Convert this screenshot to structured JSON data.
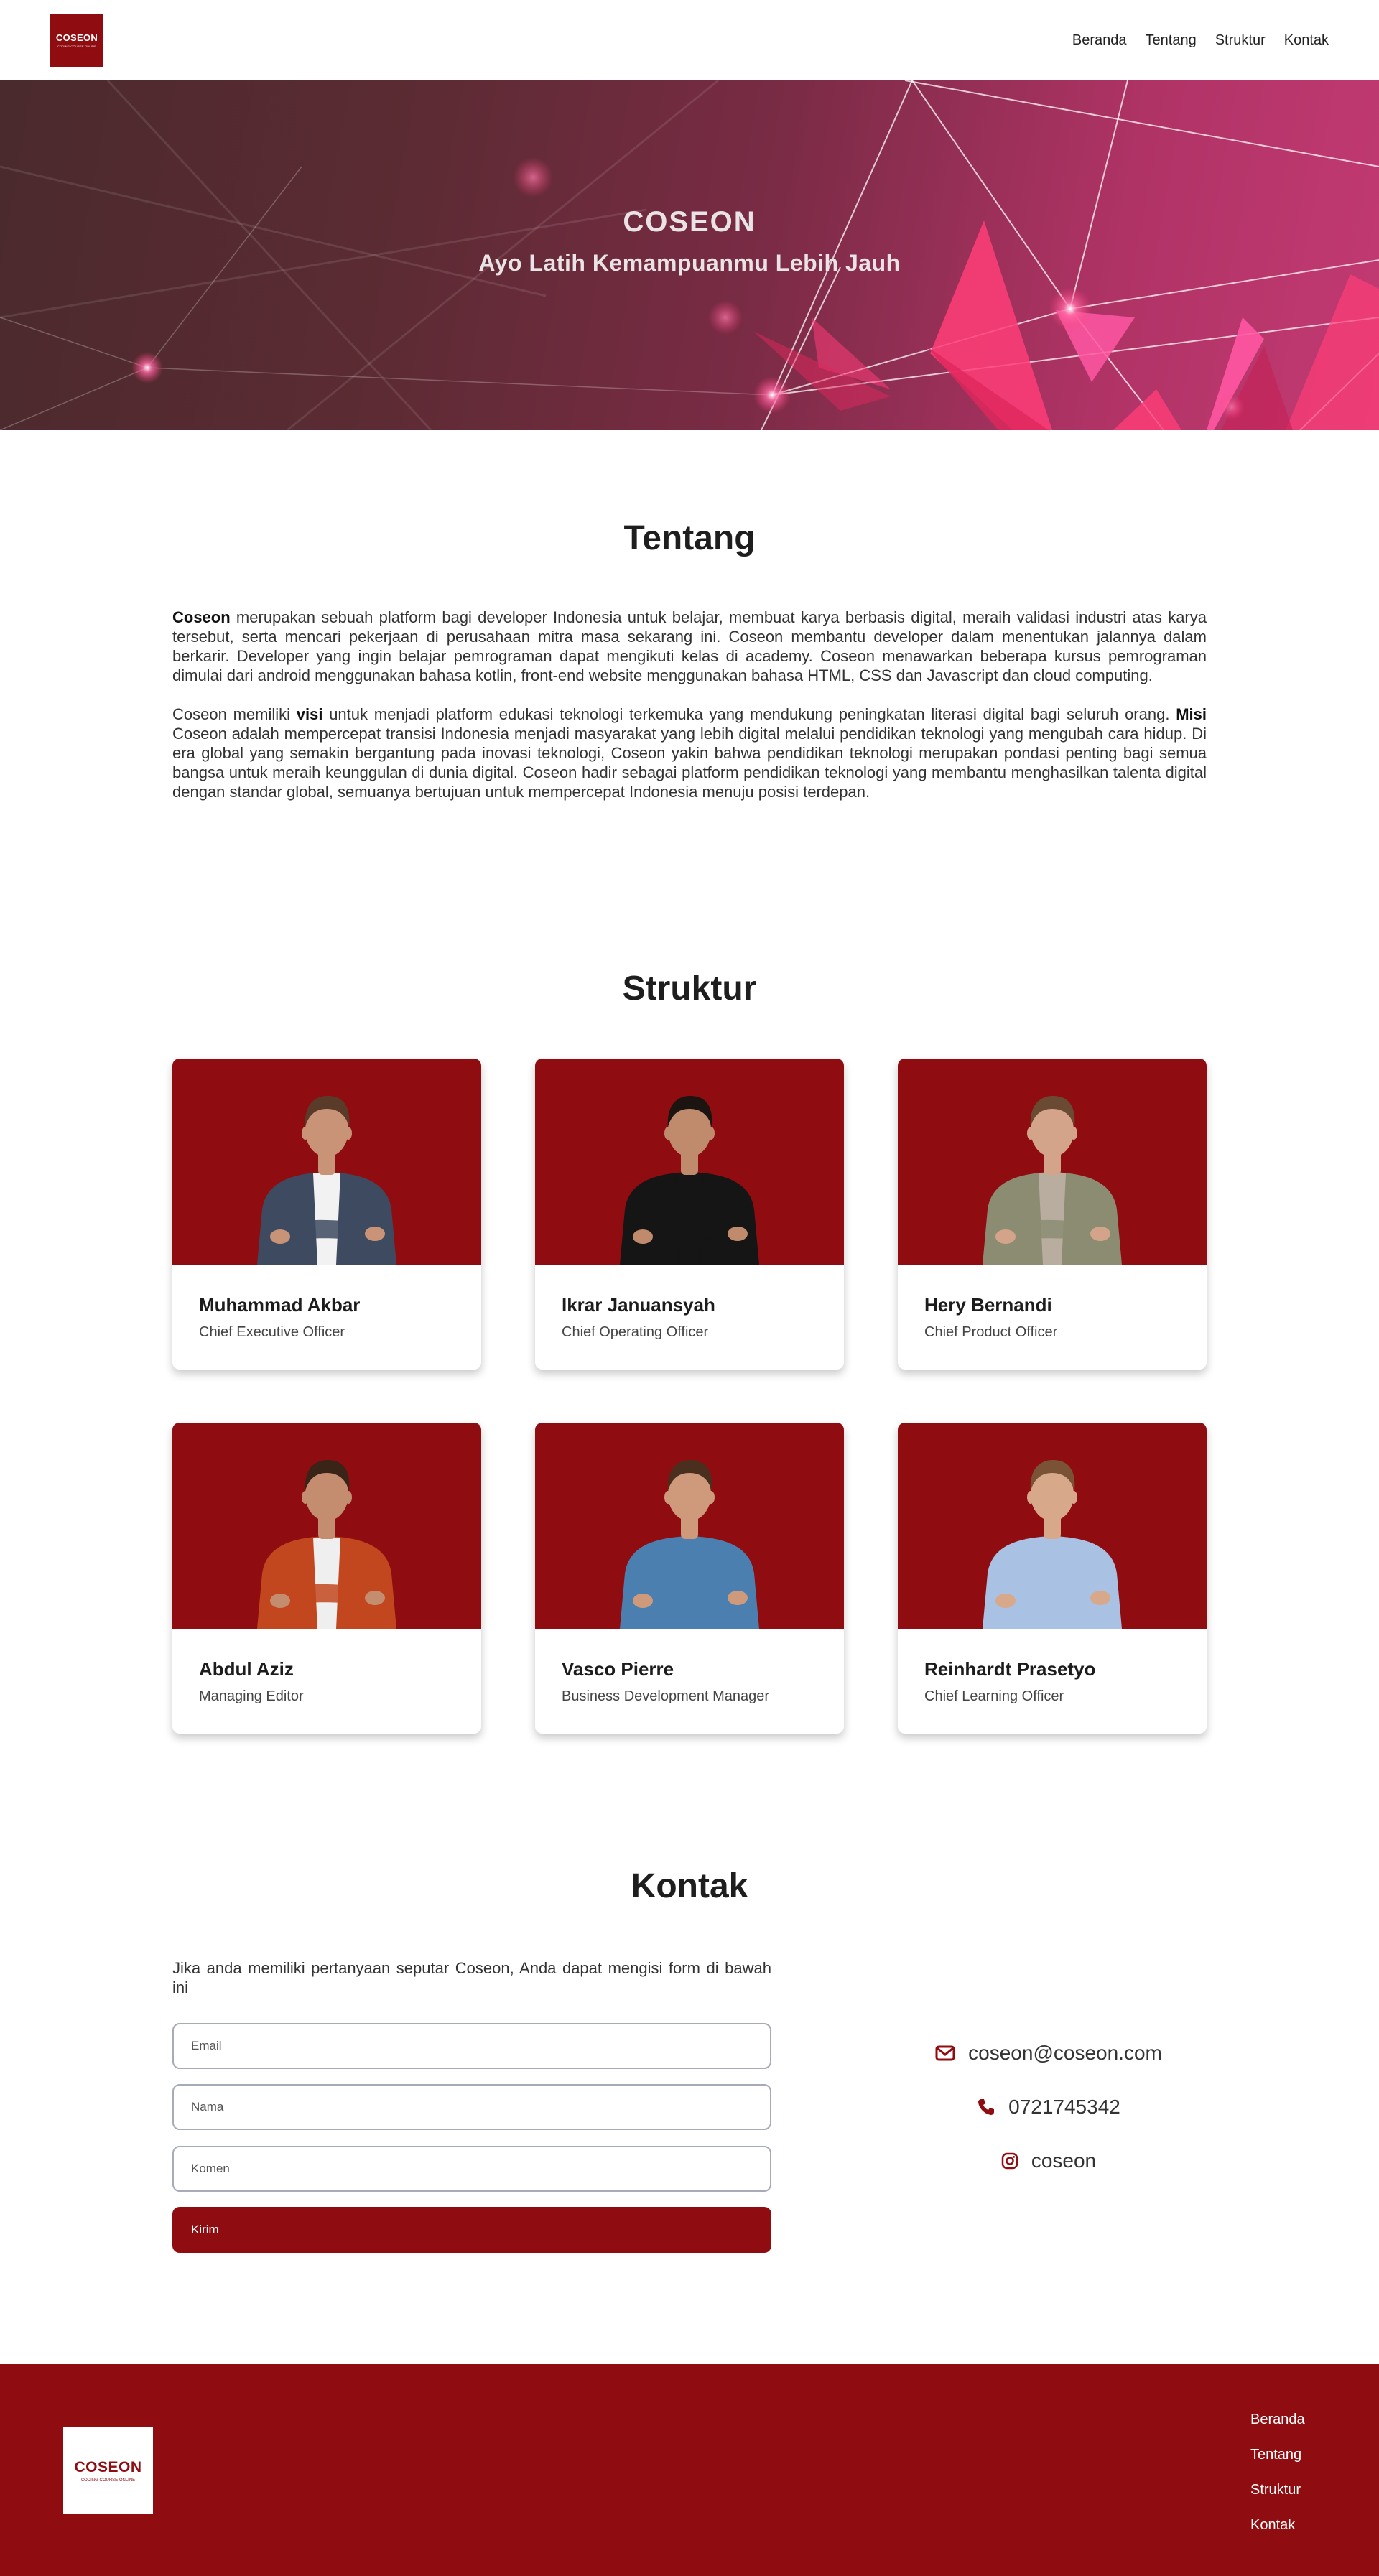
{
  "brand": {
    "name": "COSEON",
    "tagline": "CODING COURSE ONLINE",
    "primary_color": "#8f0d11"
  },
  "nav": {
    "links": [
      "Beranda",
      "Tentang",
      "Struktur",
      "Kontak"
    ]
  },
  "hero": {
    "title": "COSEON",
    "subtitle": "Ayo Latih Kemampuanmu Lebih Jauh"
  },
  "about": {
    "title": "Tentang",
    "p1_bold": "Coseon",
    "p1_text": " merupakan sebuah platform bagi developer Indonesia untuk belajar, membuat karya berbasis digital, meraih validasi industri atas karya tersebut, serta mencari pekerjaan di perusahaan mitra masa sekarang ini. Coseon membantu developer dalam menentukan jalannya dalam berkarir. Developer yang ingin belajar pemrograman dapat mengikuti kelas di academy. Coseon menawarkan beberapa kursus pemrograman dimulai dari android menggunakan bahasa kotlin, front-end website menggunakan bahasa HTML, CSS dan Javascript dan cloud computing.",
    "p2_a": "Coseon memiliki ",
    "p2_visi": "visi",
    "p2_b": " untuk menjadi platform edukasi teknologi terkemuka yang mendukung peningkatan literasi digital bagi seluruh orang. ",
    "p2_misi": "Misi",
    "p2_c": " Coseon adalah mempercepat transisi Indonesia menjadi masyarakat yang lebih digital melalui pendidikan teknologi yang mengubah cara hidup. Di era global yang semakin bergantung pada inovasi teknologi, Coseon yakin bahwa pendidikan teknologi merupakan pondasi penting bagi semua bangsa untuk meraih keunggulan di dunia digital. Coseon hadir sebagai platform pendidikan teknologi yang membantu menghasilkan talenta digital dengan standar global, semuanya bertujuan untuk mempercepat Indonesia menuju posisi terdepan."
  },
  "structure": {
    "title": "Struktur",
    "members": [
      {
        "name": "Muhammad Akbar",
        "role": "Chief Executive Officer",
        "shirt": "#3e4a60",
        "inner": "#f2f2f2",
        "skin": "#c99377",
        "hair": "#5a3b2a"
      },
      {
        "name": "Ikrar Januansyah",
        "role": "Chief Operating Officer",
        "shirt": "#151515",
        "inner": "#151515",
        "skin": "#c08a6d",
        "hair": "#1c1410"
      },
      {
        "name": "Hery Bernandi",
        "role": "Chief Product Officer",
        "shirt": "#8b8c72",
        "inner": "#b9ada0",
        "skin": "#d3a489",
        "hair": "#6b4a33"
      },
      {
        "name": "Abdul Aziz",
        "role": "Managing Editor",
        "shirt": "#c2471f",
        "inner": "#efefef",
        "skin": "#c48d70",
        "hair": "#3a2418"
      },
      {
        "name": "Vasco Pierre",
        "role": "Business Development Manager",
        "shirt": "#4a7fb0",
        "inner": "#4a7fb0",
        "skin": "#cf9a7c",
        "hair": "#4a2f1e"
      },
      {
        "name": "Reinhardt Prasetyo",
        "role": "Chief Learning Officer",
        "shirt": "#a9c1e2",
        "inner": "#a9c1e2",
        "skin": "#d8a88b",
        "hair": "#7a5235"
      }
    ]
  },
  "contact": {
    "title": "Kontak",
    "description": "Jika anda memiliki pertanyaan seputar Coseon, Anda dapat mengisi form di bawah ini",
    "email_placeholder": "Email",
    "name_placeholder": "Nama",
    "comment_placeholder": "Komen",
    "submit_label": "Kirim",
    "email": "coseon@coseon.com",
    "phone": "0721745342",
    "instagram": "coseon",
    "icon_color": "#8f0d11"
  },
  "footer": {
    "links": [
      "Beranda",
      "Tentang",
      "Struktur",
      "Kontak"
    ]
  }
}
